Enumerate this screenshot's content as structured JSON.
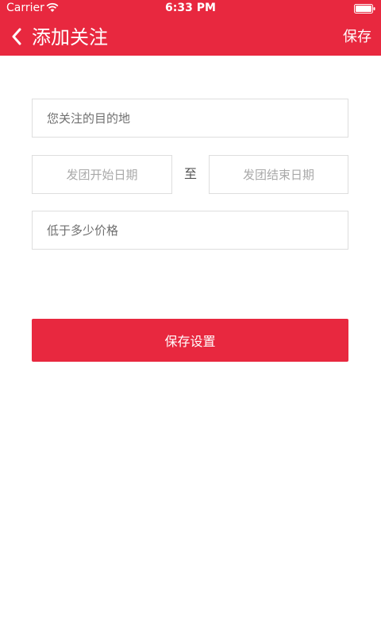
{
  "status_bar": {
    "carrier": "Carrier",
    "time": "6:33 PM"
  },
  "nav": {
    "title": "添加关注",
    "save_label": "保存",
    "back_icon": "chevron-left-icon"
  },
  "form": {
    "destination_placeholder": "您关注的目的地",
    "start_date_placeholder": "发团开始日期",
    "to_label": "至",
    "end_date_placeholder": "发团结束日期",
    "price_placeholder": "低于多少价格"
  },
  "actions": {
    "save_settings_label": "保存设置"
  },
  "colors": {
    "accent": "#e8283f",
    "field_border": "#dedede",
    "background": "#ffffff"
  }
}
